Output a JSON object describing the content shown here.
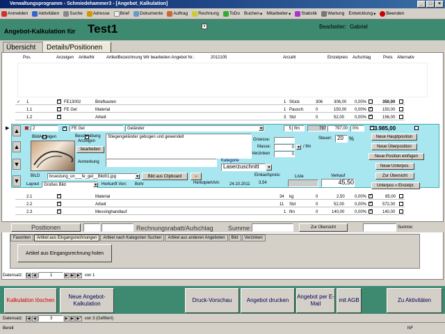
{
  "window": {
    "title": "Verwaltungsprogramm - Schmiedehammer3 - [Angebot_Kalkulation]",
    "min": "_",
    "max": "□",
    "close": "×"
  },
  "menu": [
    "Anmelden",
    "Aktivitäten",
    "Suche",
    "Adresse",
    "Brief",
    "Dokumente",
    "Auftrag",
    "Rechnung",
    "ToDo",
    "Buchen",
    "Mitarbeiter",
    "Statistik",
    "Wartung",
    "Entwicklung",
    "Beenden"
  ],
  "header": {
    "label": "Angebot-Kalkulation für",
    "name": "Test1",
    "bearbeiter_label": "Bearbeiter:",
    "bearbeiter": "Gabriel"
  },
  "tabs": {
    "uebersicht": "Übersicht",
    "details": "Details/Positionen"
  },
  "columns": {
    "pos": "Pos.",
    "anzeigen": "Anzeigen",
    "artikelnr": "ArtikelNr",
    "bez": "ArtikelBezeichnung  Wir bearbeiten Angebot Nr.:",
    "angebot_nr": "2012105",
    "anzahl": "Anzahl",
    "einzelpreis": "Einzelpreis",
    "aufschlag": "Aufschlag",
    "preis": "Preis",
    "alternativ": "Alternativ"
  },
  "rows_top": [
    {
      "pos": "1",
      "nr": "FE13002",
      "bez": "Briefkasten",
      "anz": "1",
      "einh": "Stück",
      "a": "306",
      "ep": "306,00",
      "auf": "0,00%",
      "preis": "350,00"
    },
    {
      "pos": "1.1",
      "nr": "FE Gel",
      "bez": "Material",
      "anz": "1",
      "einh": "Pausch.",
      "a": "0",
      "ep": "150,00",
      "auf": "0,00%",
      "preis": "150,00"
    },
    {
      "pos": "1.2",
      "nr": "",
      "bez": "Arbeit",
      "anz": "3",
      "einh": "Std",
      "a": "0",
      "ep": "52,00",
      "auf": "0,00%",
      "preis": "156,00"
    }
  ],
  "selected": {
    "pos": "2",
    "nr": "FE Gel",
    "bez": "Geländer",
    "anz": "5",
    "einh": "lfm",
    "a": "797",
    "ep": "797,00",
    "auf": "0%",
    "preis": "3.985,00",
    "bildanzeigen": "BildAnzeigen",
    "beschreibung": "Beschreibung",
    "anzeigen": "Anzeigen",
    "bearbeiten": "bearbeiten",
    "desc_text": "Stiegengeländer gebogen und gewendelt",
    "anmerkung": "Anmerkung",
    "bild": "BILD",
    "bild_file": "bruestung_un___fe_gel__Bild01.jpg",
    "bild_clip": "Bild aus Clipboard",
    "layout": "Layout",
    "layout_val": "Großes Bild",
    "herkunft_label": "Herkunft Von:",
    "herkunft": "Bohr",
    "kopiert_label": "HerkopiertAm:",
    "kopiert": "24.10.2011",
    "groesse": "Groesse:",
    "masse": "Masse:",
    "masse_val": "0",
    "masse_unit": "/ lfm",
    "verzinken": "Verzinken",
    "verzinken_val": "0",
    "steuer": "Steuer:",
    "steuer_val": "20",
    "pct": "%",
    "kategorie": "Kategorie",
    "kategorie_val": "Laserzuschnitt",
    "ek_label": "Einkaufspreis:",
    "ek": "3,54",
    "liste": "Liste",
    "verkauf": "Verkauf",
    "verkauf_val": "45,50"
  },
  "side_buttons": [
    "Neue Hauptposition",
    "Neue Überposition",
    "Neue Position  einfügen",
    "Neue Unterpos.",
    "Zur Übersicht",
    "Unterpos » Einzelpr."
  ],
  "rows_bottom": [
    {
      "pos": "2.1",
      "bez": "Material",
      "anz": "34",
      "einh": "kg",
      "a": "0",
      "ep": "2,50",
      "auf": "0,00%",
      "preis": "85,00"
    },
    {
      "pos": "2.2",
      "bez": "Arbeit",
      "anz": "11",
      "einh": "Std",
      "a": "0",
      "ep": "52,00",
      "auf": "0,00%",
      "preis": "572,00"
    },
    {
      "pos": "2.3",
      "bez": "Messinghandlauf",
      "anz": "1",
      "einh": "lfm",
      "a": "0",
      "ep": "140,00",
      "auf": "0,00%",
      "preis": "140,00"
    }
  ],
  "footer_row": {
    "positionen": "Positionen",
    "rabatt": "Rechnungsrabatt/Aufschlag",
    "summe": "Summe:",
    "zur": "Zur Übersicht",
    "summe2": "Summe:"
  },
  "subtabs": [
    "Favoriten",
    "Artikel aus Eingangsrechnungen",
    "Artikel nach Kategorien Suchen",
    "Artikel aus anderen Angeboten",
    "Bild",
    "Verzinken"
  ],
  "subtab_button": "Artikel aus Eingangsrechnung holen",
  "nav1": {
    "label": "Datensatz:",
    "val": "1",
    "of": "von 1"
  },
  "bottom_buttons": [
    "Kalkulation löschen",
    "Neue Angebot-Kalkulation",
    "Druck-Vorschau",
    "Angebot drucken",
    "Angebot per E-Mail",
    "mit AGB",
    "Zu Aktivitäten"
  ],
  "nav2": {
    "label": "Datensatz:",
    "val": "3",
    "of": "von 3 (Gefiltert)"
  },
  "status": {
    "left": "Bereit",
    "right": "NF"
  }
}
